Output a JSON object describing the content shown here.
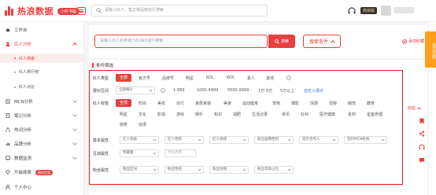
{
  "topbar": {
    "logo_text": "热浪数据",
    "edition": "小红书版",
    "search_placeholder": "请输入红人、笔记或品牌进行搜索",
    "vip_label": "高级版"
  },
  "sidebar": {
    "workbench": "工作台",
    "kol_analysis": "红人分析",
    "kol_search": "红人搜索",
    "kol_ranking": "红人排行榜",
    "kol_compare": "红人对比",
    "mcn_analysis": "MCN分析",
    "note_analysis": "笔记分析",
    "topic_analysis": "热词分析",
    "brand_analysis": "品牌分析",
    "data_monitor": "数据监测",
    "upgrade": "升级续费",
    "upgrade_badge": "限时优惠",
    "personal_center": "个人中心"
  },
  "search": {
    "placeholder": "请输入红人名称或小红书ID进行搜索",
    "button": "搜索",
    "conditions": "搜索条件",
    "favorites": "添加收藏"
  },
  "filters": {
    "section_title": "条件筛选",
    "type": {
      "label": "红人类型",
      "options": [
        "全部",
        "官方号",
        "品牌号",
        "明星",
        "KOL",
        "KOC",
        "素人",
        "其他"
      ]
    },
    "price": {
      "label": "报价区间",
      "select": "全部报价",
      "options": [
        "1-999",
        "1000-4999",
        "5000-9999",
        "1万-5万",
        "5万以上"
      ],
      "custom": "自定义报价"
    },
    "tags": {
      "label": "红人标签",
      "row1": [
        "全部",
        "时尚",
        "美妆",
        "出行",
        "家居家装",
        "美食",
        "运动健身",
        "宠物",
        "摄影",
        "情感",
        "母婴",
        "萌宠",
        "教育"
      ],
      "row2": [
        "明星",
        "文化",
        "影视",
        "游戏",
        "娱乐",
        "知识",
        "减肥",
        "生活记录",
        "资讯",
        "社科",
        "医疗健康",
        "素材",
        "星座命理"
      ],
      "row3": [
        "搞笑",
        "动漫"
      ],
      "collapse": "收起"
    },
    "basic": {
      "label": "基本属性",
      "selects": [
        "红人等级",
        "红人性别",
        "红人地域",
        "粉丝画像性别",
        "是否合作人",
        "签约MCN机构"
      ]
    },
    "interaction": {
      "label": "互动属性",
      "selects": [
        "赞藏量"
      ],
      "inputs": [
        "平均点赞"
      ]
    },
    "fans": {
      "label": "粉丝属性",
      "selects": [
        "粉丝区间",
        "粉丝性别",
        "粉丝地域",
        "粉丝年龄占比"
      ]
    }
  },
  "rightbar": {
    "feedback": "意见反馈"
  },
  "colors": {
    "brand": "#e83f3f",
    "feedback": "#ff9f1a"
  }
}
